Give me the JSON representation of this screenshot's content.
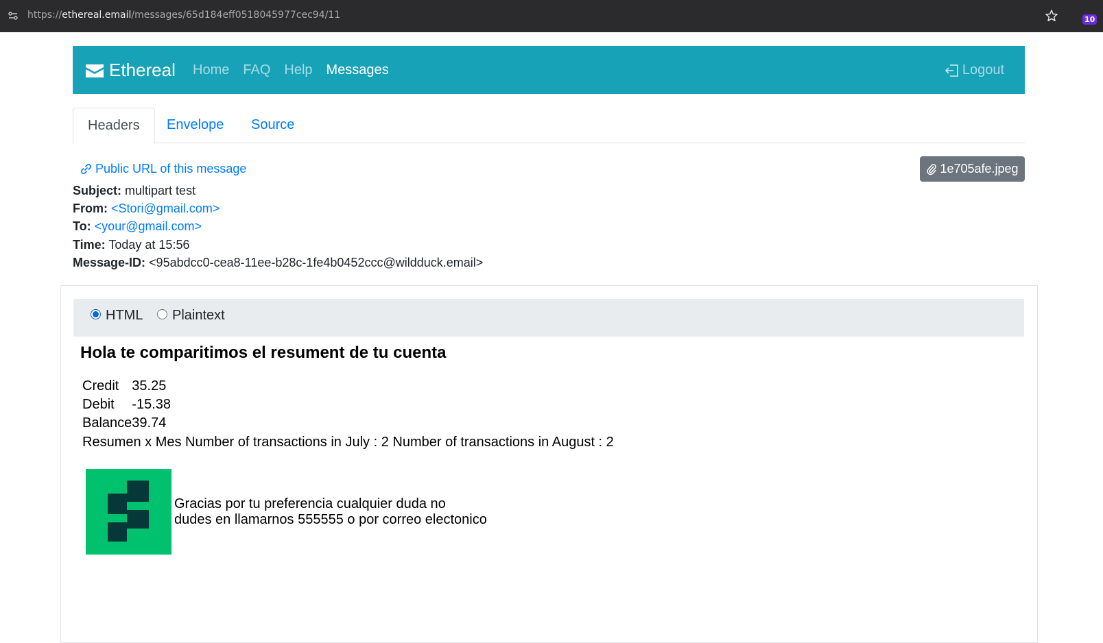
{
  "browser": {
    "url_scheme": "https://",
    "url_host": "ethereal.email",
    "url_path": "/messages/65d184eff0518045977cec94/11",
    "extension_badge": "10"
  },
  "navbar": {
    "brand": "Ethereal",
    "links": [
      "Home",
      "FAQ",
      "Help",
      "Messages"
    ],
    "active_link": "Messages",
    "logout": "Logout",
    "color": "#17a2b8"
  },
  "tabs": [
    {
      "label": "Headers",
      "active": true
    },
    {
      "label": "Envelope",
      "active": false
    },
    {
      "label": "Source",
      "active": false
    }
  ],
  "message": {
    "public_url_label": "Public URL of this message",
    "attachment": "1e705afe.jpeg",
    "headers": {
      "subject_label": "Subject:",
      "subject": "multipart test",
      "from_label": "From:",
      "from": "<Stori@gmail.com>",
      "to_label": "To:",
      "to": "<your@gmail.com>",
      "time_label": "Time:",
      "time": "Today at 15:56",
      "message_id_label": "Message-ID:",
      "message_id": "<95abdcc0-cea8-11ee-b28c-1fe4b0452ccc@wildduck.email>"
    }
  },
  "view_toggle": {
    "options": [
      "HTML",
      "Plaintext"
    ],
    "selected": "HTML"
  },
  "email_body": {
    "heading": "Hola te comparitimos el resument de tu cuenta",
    "summary": [
      {
        "label": "Credit",
        "value": "35.25"
      },
      {
        "label": "Debit",
        "value": "-15.38"
      },
      {
        "label": "Balance",
        "value": "39.74"
      }
    ],
    "monthly_summary": "Resumen x Mes Number of transactions in July : 2 Number of transactions in August : 2",
    "thanks_line1": "Gracias por tu preferencia cualquier duda no",
    "thanks_line2": "dudes en llamarnos 555555 o por correo electonico",
    "logo_icon": "stori-logo-icon",
    "logo_colors": {
      "background": "#00c16e",
      "mark": "#06383a"
    }
  }
}
